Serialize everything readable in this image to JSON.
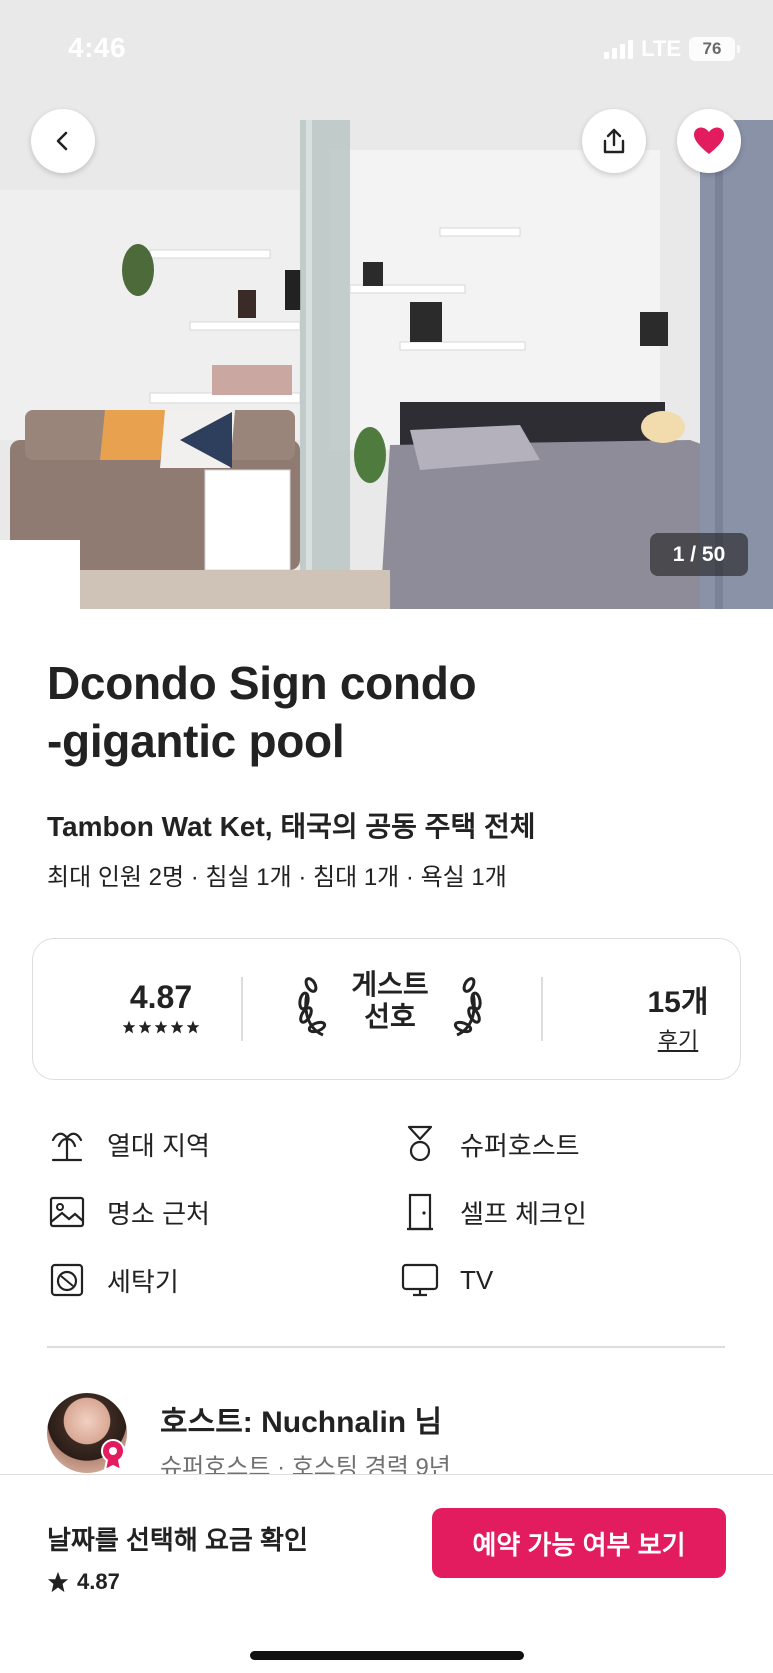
{
  "status_bar": {
    "time": "4:46",
    "network": "LTE",
    "battery": "76"
  },
  "hero": {
    "photo_counter": "1 / 50",
    "back_icon": "chevron-left-icon",
    "share_icon": "share-icon",
    "favorite_icon": "heart-filled-icon",
    "favorite_color": "#e31c5f"
  },
  "listing": {
    "title_line1": "Dcondo Sign condo",
    "title_line2": "-gigantic pool",
    "location": "Tambon Wat Ket, 태국의 공동 주택 전체",
    "capacity": "최대 인원 2명 · 침실 1개 · 침대 1개 · 욕실 1개"
  },
  "rating_card": {
    "score": "4.87",
    "stars": 5,
    "guest_favorite_line1": "게스트",
    "guest_favorite_line2": "선호",
    "review_count": "15개",
    "review_link": "후기"
  },
  "amenities": [
    {
      "icon": "palm-tree-icon",
      "label": "열대 지역"
    },
    {
      "icon": "superhost-medal-icon",
      "label": "슈퍼호스트"
    },
    {
      "icon": "landmark-image-icon",
      "label": "명소 근처"
    },
    {
      "icon": "door-icon",
      "label": "셀프 체크인"
    },
    {
      "icon": "washer-icon",
      "label": "세탁기"
    },
    {
      "icon": "tv-icon",
      "label": "TV"
    }
  ],
  "host": {
    "name": "호스트: Nuchnalin 님",
    "meta": "슈퍼호스트 · 호스팅 경력 9년"
  },
  "footer": {
    "date_prompt": "날짜를 선택해 요금 확인",
    "rating": "4.87",
    "reserve_label": "예약 가능 여부 보기",
    "accent_color": "#e31c5f"
  }
}
